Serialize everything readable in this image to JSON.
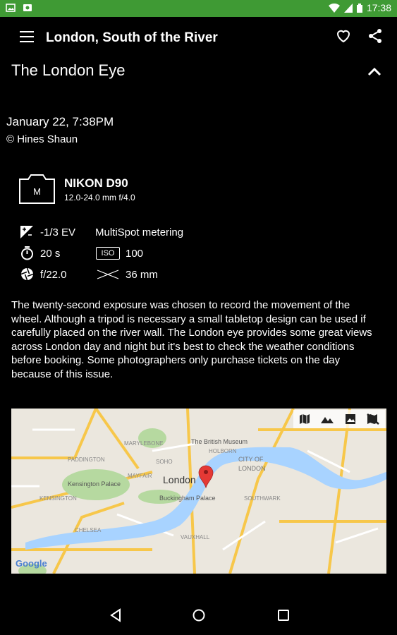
{
  "status_bar": {
    "time": "17:38"
  },
  "app_bar": {
    "title": "London, South of the River"
  },
  "section": {
    "title": "The London Eye"
  },
  "photo": {
    "date": "January 22, 7:38PM",
    "author": "© Hines Shaun",
    "camera_mode": "M",
    "camera_name": "NIKON D90",
    "lens": "12.0-24.0 mm f/4.0",
    "exposure_comp": "-1/3 EV",
    "metering": "MultiSpot metering",
    "shutter": "20 s",
    "iso_label": "ISO",
    "iso": "100",
    "aperture": "f/22.0",
    "focal_length": "36 mm",
    "description": "The twenty-second exposure was chosen to record the movement of the wheel. Although a tripod is necessary a small tabletop design can be used if carefully placed on the river wall. The London eye provides some great views across London day and night but it's best to check the weather conditions before booking. Some photographers only purchase tickets on the day because of this issue."
  },
  "map": {
    "city_label": "London",
    "labels": {
      "british_museum": "The British Museum",
      "kensington": "Kensington Palace",
      "buckingham": "Buckingham Palace",
      "city_of": "CITY OF",
      "london_city": "LONDON",
      "marylebone": "MARYLEBONE",
      "soho": "SOHO",
      "mayfair": "MAYFAIR",
      "kensington_area": "KENSINGTON",
      "chelsea": "CHELSEA",
      "vauxhall": "VAUXHALL",
      "holborn": "HOLBORN",
      "paddington": "PADDINGTON",
      "southwark": "SOUTHWARK",
      "google": "Google"
    }
  }
}
